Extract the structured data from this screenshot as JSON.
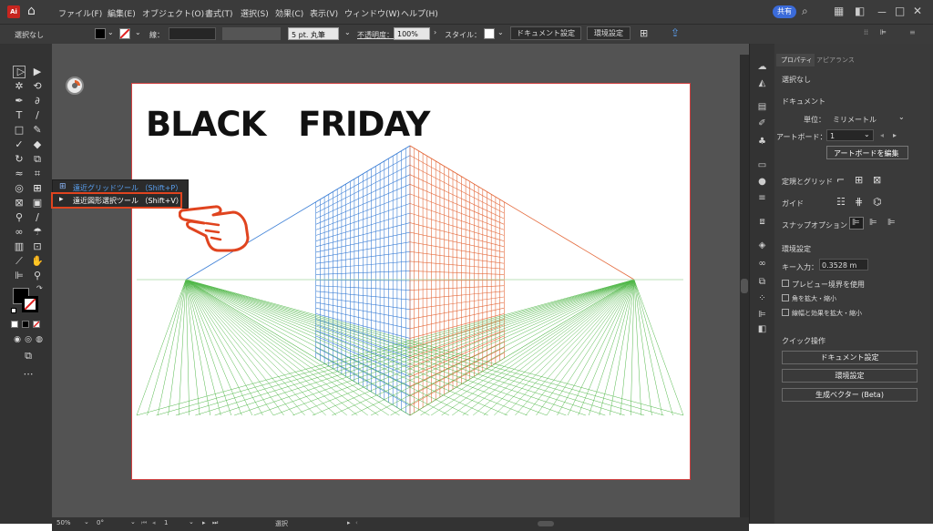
{
  "menubar": {
    "logo": "Ai",
    "menus": [
      "ファイル(F)",
      "編集(E)",
      "オブジェクト(O)",
      "書式(T)",
      "選択(S)",
      "効果(C)",
      "表示(V)",
      "ウィンドウ(W)",
      "ヘルプ(H)"
    ],
    "share_label": "共有",
    "window_controls": [
      "－",
      "□",
      "✕"
    ]
  },
  "controlbar": {
    "selection": "選択なし",
    "stroke_label": "線：",
    "brush_label": "5 pt. 丸筆",
    "opacity_label": "不透明度：",
    "opacity_value": "100%",
    "style_label": "スタイル：",
    "doc_setup_button": "ドキュメント設定",
    "prefs_button": "環境設定"
  },
  "flyout": {
    "items": [
      {
        "label": "遠近グリッドツール （Shift+P）",
        "icon": "perspective-grid-icon"
      },
      {
        "label": "遠近図形選択ツール （Shift+V）",
        "icon": "perspective-selection-icon"
      }
    ]
  },
  "artboard": {
    "title_text": "BLACK　FRIDAY"
  },
  "properties_panel": {
    "tabs": [
      "プロパティ",
      "アピアランス"
    ],
    "selection": "選択なし",
    "document_header": "ドキュメント",
    "unit_label": "単位：",
    "unit_value": "ミリメートル",
    "artboard_label": "アートボード：",
    "artboard_value": "1",
    "edit_artboard_button": "アートボードを編集",
    "rulers_grids_label": "定規とグリッド",
    "guides_label": "ガイド",
    "snap_label": "スナップオプション",
    "prefs_header": "環境設定",
    "key_increment_label": "キー入力：",
    "key_increment_value": "0.3528 m",
    "preview_bounds_label": "プレビュー境界を使用",
    "scale_corners_label": "角を拡大・縮小",
    "scale_strokes_label": "線幅と効果を拡大・縮小",
    "quick_actions_header": "クイック操作",
    "btn_doc_setup": "ドキュメント設定",
    "btn_prefs": "環境設定",
    "btn_gen_vector": "生成ベクター (Beta)"
  },
  "statusbar": {
    "zoom": "50%",
    "rotation": "0°",
    "artboard_num": "1",
    "tool": "選択"
  },
  "colors": {
    "accent": "#3b6bd9",
    "highlight": "#e0441f",
    "grid_blue": "#3c7fd6",
    "grid_orange": "#e46a3c",
    "grid_green": "#52b84a"
  }
}
